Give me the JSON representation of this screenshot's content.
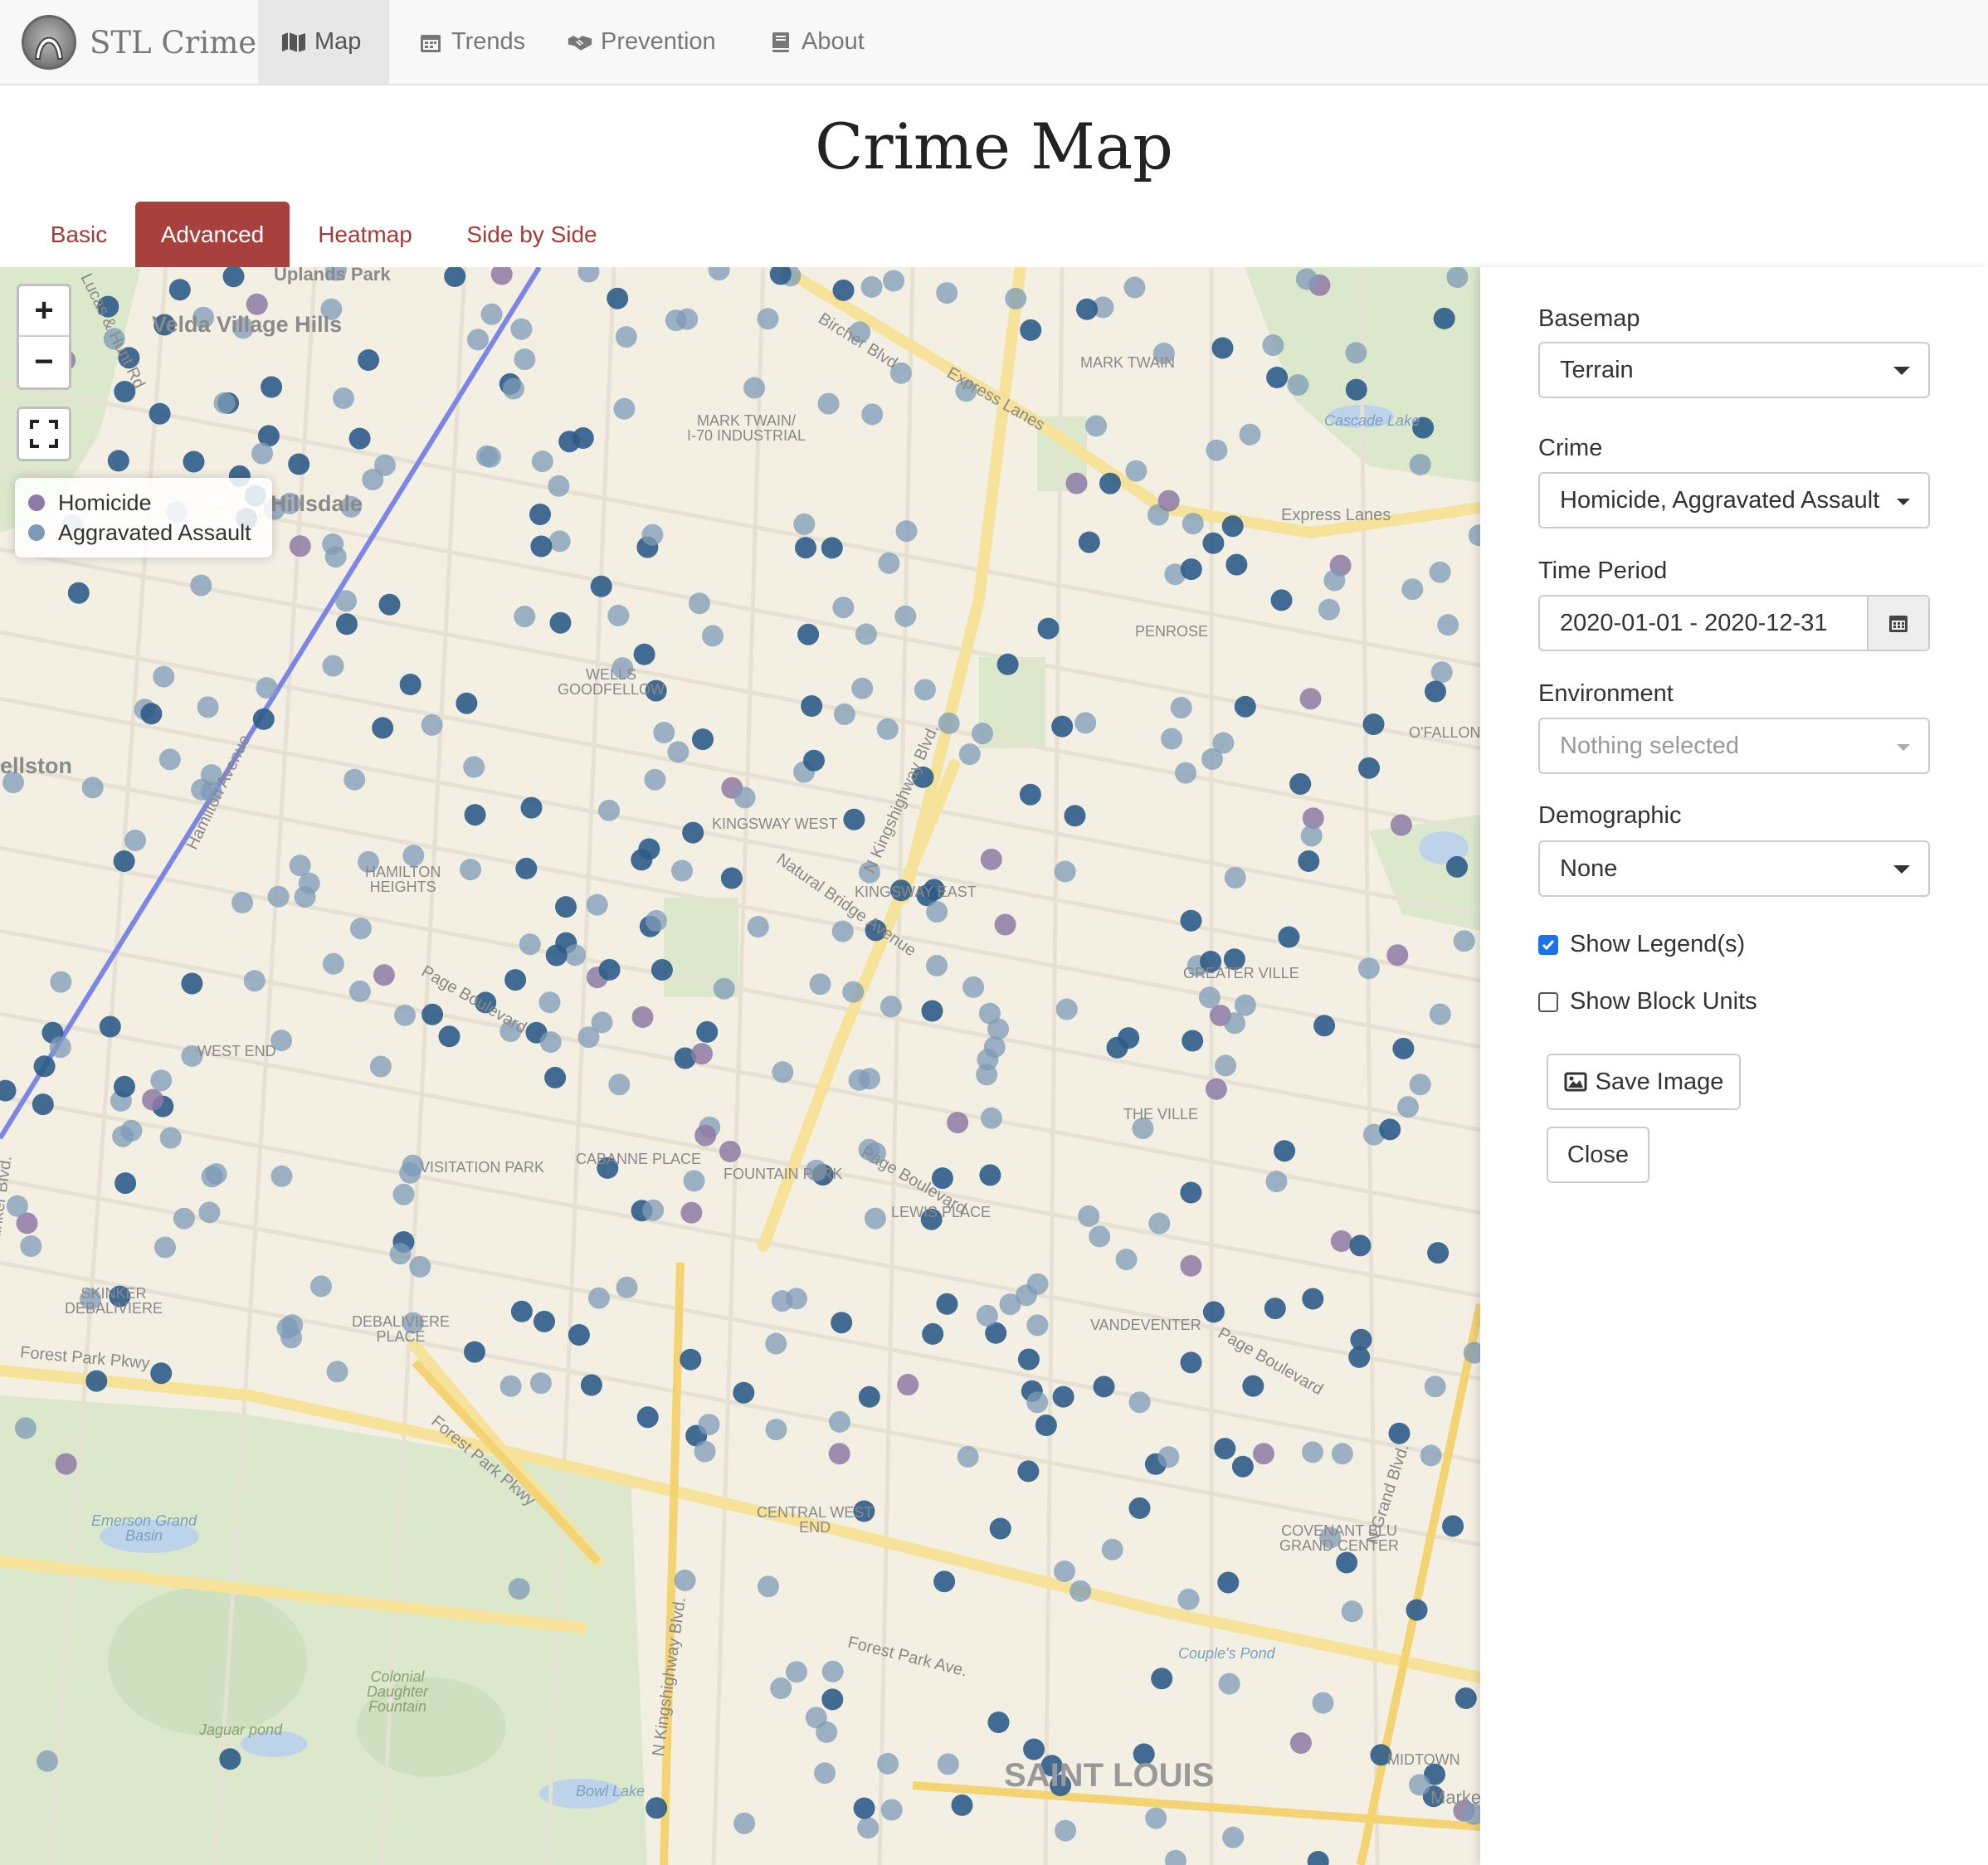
{
  "navbar": {
    "brand": "STL Crime",
    "items": [
      {
        "label": "Map",
        "icon": "map-icon",
        "active": true
      },
      {
        "label": "Trends",
        "icon": "calendar-icon",
        "active": false
      },
      {
        "label": "Prevention",
        "icon": "handshake-icon",
        "active": false
      },
      {
        "label": "About",
        "icon": "book-icon",
        "active": false
      }
    ]
  },
  "page_title": "Crime Map",
  "tabs": [
    {
      "label": "Basic",
      "active": false
    },
    {
      "label": "Advanced",
      "active": true
    },
    {
      "label": "Heatmap",
      "active": false
    },
    {
      "label": "Side by Side",
      "active": false
    }
  ],
  "map": {
    "zoom_in": "+",
    "zoom_out": "−",
    "legend": [
      {
        "label": "Homicide",
        "color": "#8e7aa6"
      },
      {
        "label": "Aggravated Assault",
        "color": "#7d9bb7"
      }
    ],
    "labels": {
      "velda": "Velda Village Hills",
      "hillsdale": "Hillsdale",
      "ellston": "ellston",
      "mark_twain_i70": "MARK TWAIN/\nI-70 INDUSTRIAL",
      "mark_twain": "MARK TWAIN",
      "wells": "WELLS\nGOODFELLOW",
      "penrose": "PENROSE",
      "kingsway_west": "KINGSWAY WEST",
      "kingsway_east": "KINGSWAY EAST",
      "hamilton": "HAMILTON\nHEIGHTS",
      "greater_ville": "GREATER VILLE",
      "west_end": "WEST END",
      "the_ville": "THE VILLE",
      "visitation": "VISITATION PARK",
      "cabanne": "CABANNE PLACE",
      "fountain": "FOUNTAIN PARK",
      "lewis": "LEWIS PLACE",
      "skinker": "SKINKER\nDEBALIVIERE",
      "debaliviere": "DEBALIVIERE\nPLACE",
      "vandeventer": "VANDEVENTER",
      "central_west": "CENTRAL WEST\nEND",
      "covenant": "COVENANT BLU\nGRAND CENTER",
      "midtown": "MIDTOWN",
      "saint_louis": "SAINT LOUIS",
      "emerson": "Emerson Grand\nBasin",
      "colonial": "Colonial\nDaughter\nFountain",
      "jaguar": "Jaguar pond",
      "bowl_lake": "Bowl Lake",
      "couples_pond": "Couple's Pond",
      "cascade_lake": "Cascade Lake",
      "forest_park_pkwy": "Forest Park Pkwy",
      "forest_park_ave": "Forest Park Ave.",
      "page_blvd": "Page Boulevard",
      "page_blvd_2": "Page Boulevard",
      "page_blvd_3": "Page Boulevard",
      "natural_bridge": "Natural Bridge Avenue",
      "express_lanes": "Express Lanes",
      "kingshighway": "N Kingshighway Blvd.",
      "skinker_blvd": "N Skinker Blvd.",
      "marke": "Marke",
      "uplands": "Uplands Park",
      "ofallon": "O'FALLON",
      "lucas_hunt": "Lucas & Hunt Rd",
      "hamilton_ave": "Hamilton Avenue",
      "grand_blvd": "N Grand Blvd.",
      "forest_pkwy_2": "Forest Park Pkwy",
      "kingshighway_2": "N Kingshighway Blvd.",
      "bircher": "Bircher Blvd",
      "express_lanes_2": "Express Lanes"
    }
  },
  "sidebar": {
    "basemap_label": "Basemap",
    "basemap_value": "Terrain",
    "crime_label": "Crime",
    "crime_value": "Homicide, Aggravated Assault",
    "time_label": "Time Period",
    "time_value": "2020-01-01 - 2020-12-31",
    "environment_label": "Environment",
    "environment_value": "Nothing selected",
    "demographic_label": "Demographic",
    "demographic_value": "None",
    "show_legends": "Show Legend(s)",
    "show_legends_checked": true,
    "show_block_units": "Show Block Units",
    "show_block_units_checked": false,
    "save_image": "Save Image",
    "close": "Close"
  },
  "colors": {
    "accent": "#a8413d",
    "homicide": "#8e7aa6",
    "assault_light": "#7d9bb7",
    "assault_dark": "#2d5c88"
  }
}
